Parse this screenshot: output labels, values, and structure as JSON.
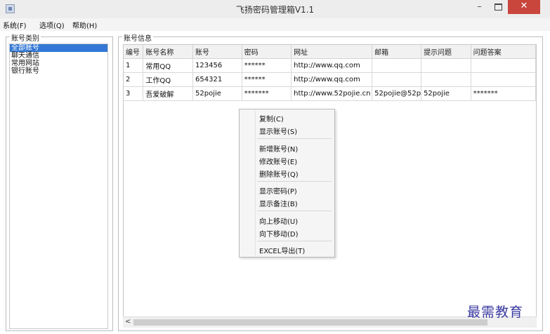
{
  "window": {
    "title": "飞扬密码管理箱V1.1",
    "minimize_label": "–",
    "close_label": "✕"
  },
  "menu": [
    "系统(F)",
    "选项(Q)",
    "帮助(H)"
  ],
  "left_panel": {
    "legend": "账号类别",
    "items": [
      "全部账号",
      "聊天通信",
      "常用网站",
      "银行账号"
    ],
    "selected": "全部账号"
  },
  "right_panel": {
    "legend": "账号信息",
    "columns": [
      "编号",
      "账号名称",
      "账号",
      "密码",
      "网址",
      "邮箱",
      "提示问题",
      "问题答案"
    ],
    "rows": [
      [
        "1",
        "常用QQ",
        "123456",
        "******",
        "http://www.qq.com",
        "",
        "",
        ""
      ],
      [
        "2",
        "工作QQ",
        "654321",
        "******",
        "http://www.qq.com",
        "",
        "",
        ""
      ],
      [
        "3",
        "吾爱破解",
        "52pojie",
        "*******",
        "http://www.52pojie.cn",
        "52pojie@52p",
        "52pojie",
        "*******"
      ]
    ]
  },
  "scrollbar": {
    "left_arrow": "<"
  },
  "context_menu": [
    [
      "复制(C)",
      "显示账号(S)"
    ],
    [
      "新增账号(N)",
      "修改账号(E)",
      "删除账号(Q)"
    ],
    [
      "显示密码(P)",
      "显示备注(B)"
    ],
    [
      "向上移动(U)",
      "向下移动(D)"
    ],
    [
      "EXCEL导出(T)"
    ]
  ],
  "watermark": "最需教育"
}
